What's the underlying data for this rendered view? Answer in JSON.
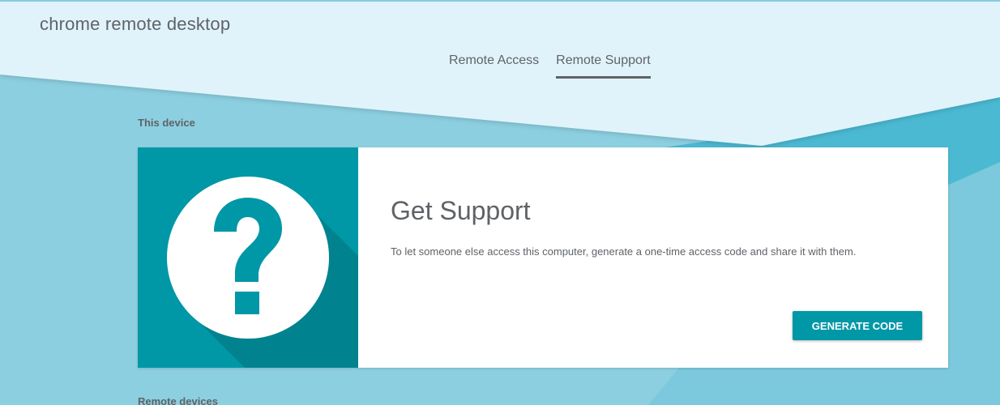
{
  "app": {
    "title": "chrome remote desktop"
  },
  "nav": {
    "tabs": [
      {
        "label": "Remote Access",
        "active": false
      },
      {
        "label": "Remote Support",
        "active": true
      }
    ]
  },
  "sections": {
    "this_device_label": "This device",
    "next_label": "Remote devices"
  },
  "support_card": {
    "title": "Get Support",
    "description": "To let someone else access this computer, generate a one-time access code and share it with them.",
    "button_label": "GENERATE CODE",
    "icon": "help-question-icon"
  },
  "colors": {
    "accent": "#0097a7",
    "header_bg": "#e0f3fb",
    "page_bg": "#8ccfe0",
    "text": "#5f6368"
  }
}
